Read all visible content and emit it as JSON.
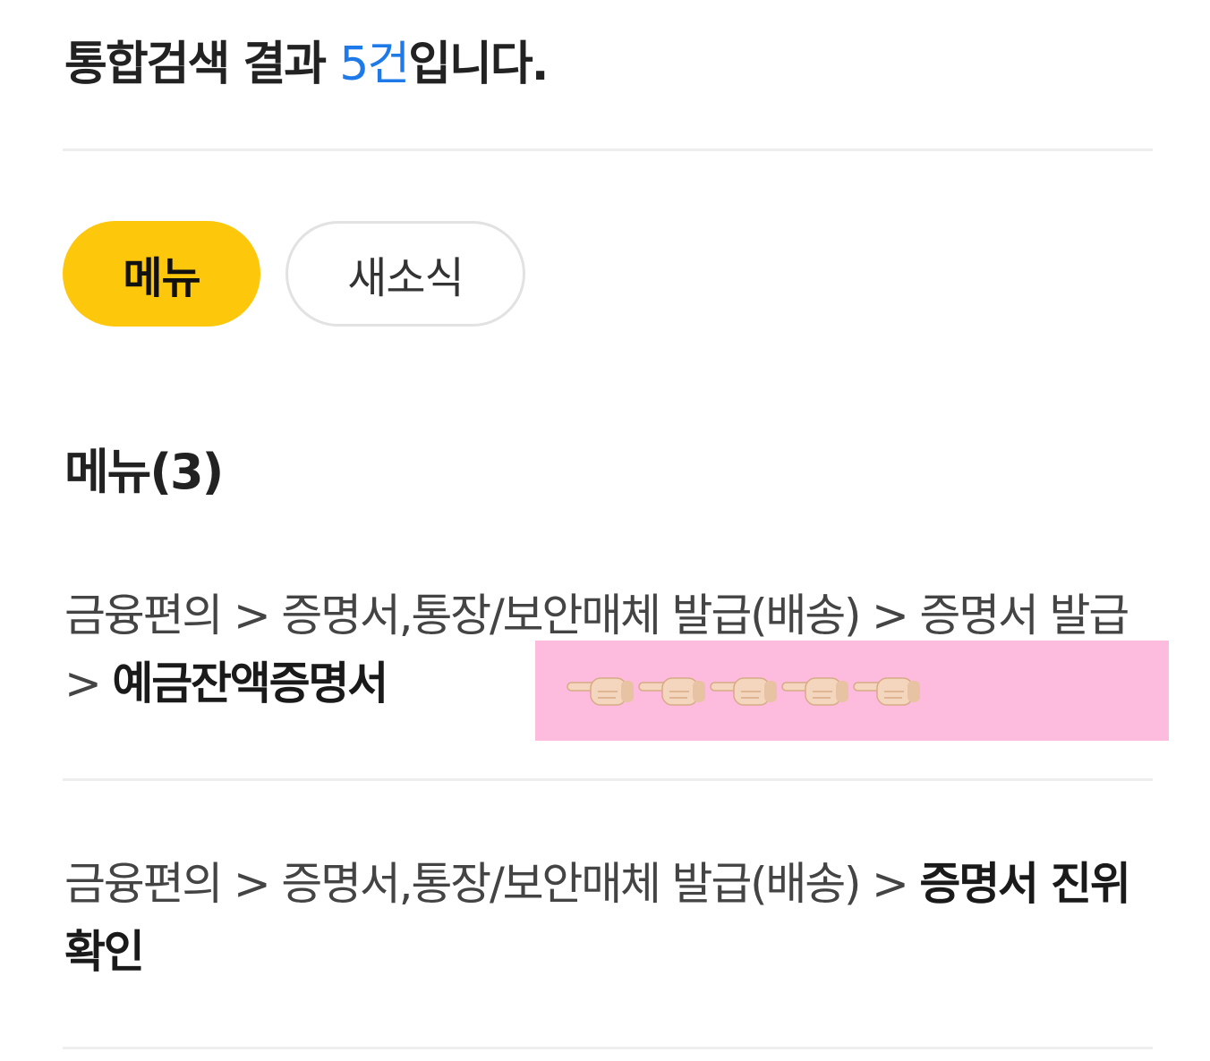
{
  "summary": {
    "prefix": "통합검색 결과 ",
    "count": "5건",
    "suffix": "입니다."
  },
  "filter_tabs": [
    {
      "label": "메뉴",
      "selected": true
    },
    {
      "label": "새소식",
      "selected": false
    }
  ],
  "menu_section": {
    "title": "메뉴(3)",
    "results": [
      {
        "path": "금융편의 > 증명서,통장/보안매체 발급(배송) > 증명서 발급 > ",
        "leaf": "예금잔액증명서"
      },
      {
        "path": "금융편의 > 증명서,통장/보안매체 발급(배송) > ",
        "leaf": "증명서 진위 확인"
      }
    ]
  },
  "annotation": {
    "background": "#fdbbdd",
    "icon": "pointing-finger-icon",
    "icon_count": 5
  },
  "colors": {
    "accent_count": "#1e7ae8",
    "selected_chip": "#fdc70c",
    "divider": "#eeeeee"
  }
}
